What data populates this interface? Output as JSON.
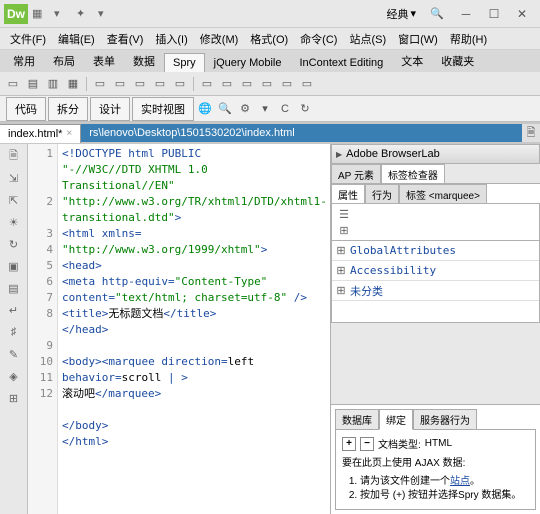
{
  "workspace_label": "经典",
  "menu": [
    "文件(F)",
    "编辑(E)",
    "查看(V)",
    "插入(I)",
    "修改(M)",
    "格式(O)",
    "命令(C)",
    "站点(S)",
    "窗口(W)",
    "帮助(H)"
  ],
  "insert_tabs": [
    "常用",
    "布局",
    "表单",
    "数据",
    "Spry",
    "jQuery Mobile",
    "InContext Editing",
    "文本",
    "收藏夹"
  ],
  "insert_active": "Spry",
  "view_buttons": [
    "代码",
    "拆分",
    "设计",
    "实时视图"
  ],
  "doc_tab_name": "index.html*",
  "doc_path": "rs\\lenovo\\Desktop\\1501530202\\index.html",
  "code_lines": [
    {
      "n": "1",
      "html": "<span class='kw'>&lt;!DOCTYPE html PUBLIC</span>"
    },
    {
      "n": "",
      "html": "<span class='str'>\"-//W3C//DTD XHTML 1.0 Transitional//EN\"</span>"
    },
    {
      "n": "",
      "html": "<span class='str'>\"http://www.w3.org/TR/xhtml1/DTD/xhtml1-transitional.dtd\"</span><span class='kw'>&gt;</span>"
    },
    {
      "n": "2",
      "html": "<span class='kw'>&lt;html xmlns=</span>"
    },
    {
      "n": "",
      "html": "<span class='str'>\"http://www.w3.org/1999/xhtml\"</span><span class='kw'>&gt;</span>"
    },
    {
      "n": "3",
      "html": "<span class='kw'>&lt;head&gt;</span>"
    },
    {
      "n": "4",
      "html": "<span class='kw'>&lt;meta http-equiv=</span><span class='str'>\"Content-Type\"</span> <span class='kw'>content=</span><span class='str'>\"text/html; charset=utf-8\"</span> <span class='kw'>/&gt;</span>"
    },
    {
      "n": "5",
      "html": "<span class='kw'>&lt;title&gt;</span><span class='txt'>无标题文档</span><span class='kw'>&lt;/title&gt;</span>"
    },
    {
      "n": "6",
      "html": "<span class='kw'>&lt;/head&gt;</span>"
    },
    {
      "n": "7",
      "html": ""
    },
    {
      "n": "8",
      "html": "<span class='kw'>&lt;body&gt;&lt;marquee direction=</span><span class='txt'>left</span> <span class='kw'>behavior=</span><span class='txt'>scroll</span> <span class='kw'>|</span> <span class='kw'>&gt;</span>"
    },
    {
      "n": "",
      "html": "<span class='txt'>滚动吧</span><span class='kw'>&lt;/marquee&gt;</span>"
    },
    {
      "n": "9",
      "html": ""
    },
    {
      "n": "10",
      "html": "<span class='kw'>&lt;/body&gt;</span>"
    },
    {
      "n": "11",
      "html": "<span class='kw'>&lt;/html&gt;</span>"
    },
    {
      "n": "12",
      "html": ""
    }
  ],
  "panels": {
    "browserlab": "Adobe BrowserLab",
    "inspector_tabs": [
      "AP 元素",
      "标签检查器"
    ],
    "inspector_active": 1,
    "prop_tabs": [
      "属性",
      "行为",
      "标签 <marquee>"
    ],
    "prop_active": 0,
    "attr_groups": [
      "GlobalAttributes",
      "Accessibility",
      "未分类"
    ]
  },
  "bindings": {
    "tabs": [
      "数据库",
      "绑定",
      "服务器行为"
    ],
    "active": 1,
    "doc_type_label": "文档类型:",
    "doc_type_value": "HTML",
    "ajax_title": "要在此页上使用 AJAX 数据:",
    "steps": [
      "请为该文件创建一个<span class='link'>站点</span>。",
      "按加号 (+) 按钮并选择Spry 数据集。"
    ]
  }
}
